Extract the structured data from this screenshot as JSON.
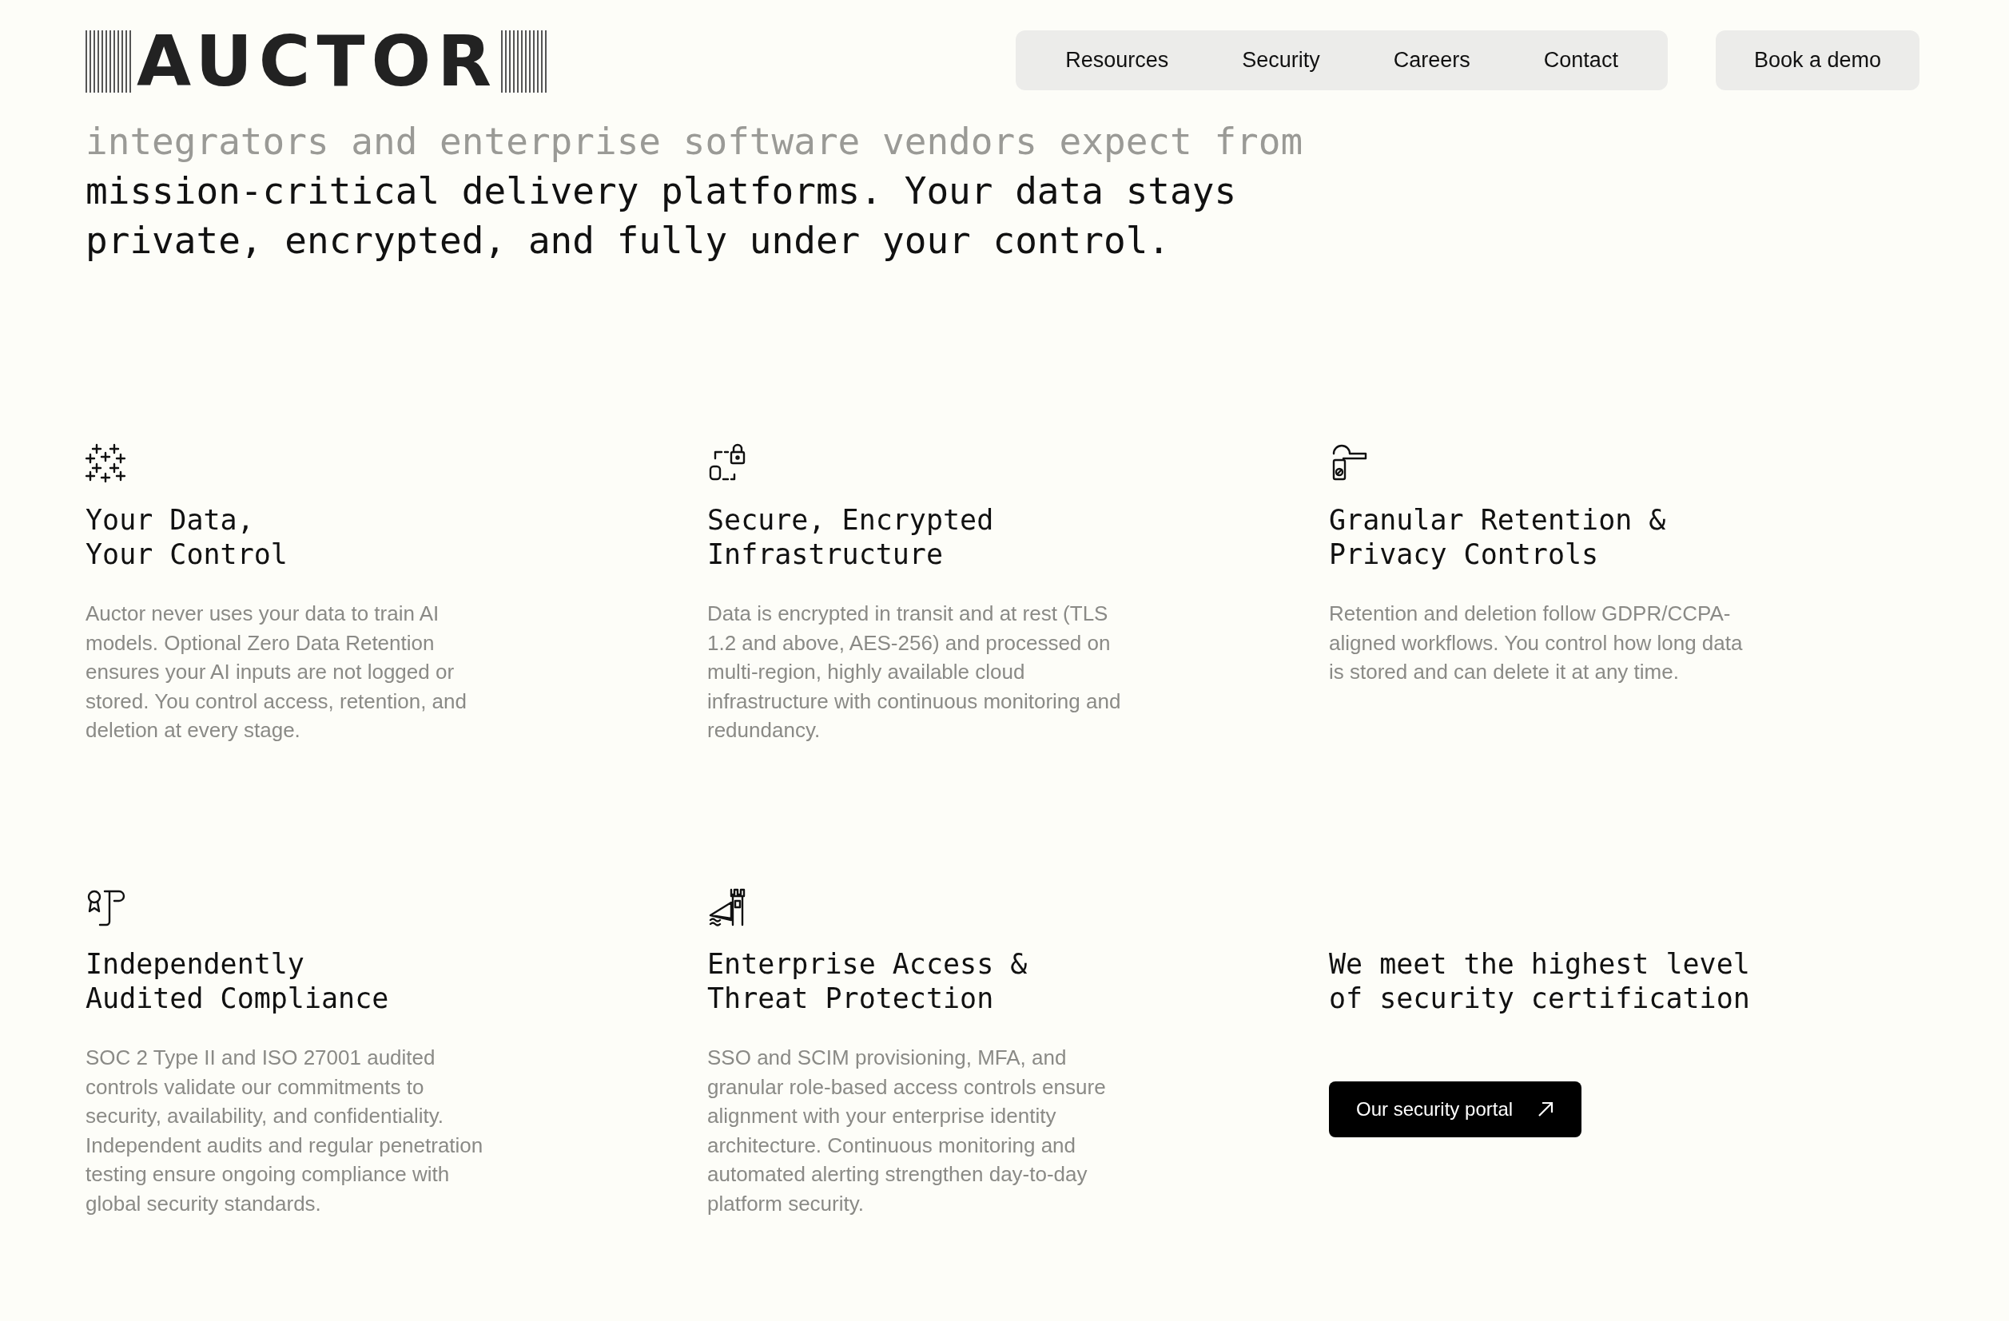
{
  "header": {
    "logo": "AUCTOR",
    "nav": [
      "Resources",
      "Security",
      "Careers",
      "Contact"
    ],
    "cta": "Book a demo"
  },
  "intro": [
    {
      "text": "integrators and enterprise software vendors expect from",
      "faded": true
    },
    {
      "text": "mission-critical delivery platforms. Your data stays",
      "faded": false
    },
    {
      "text": "private, encrypted, and fully under your control.",
      "faded": false
    }
  ],
  "features": [
    {
      "kind": "feature",
      "title": [
        "Your Data,",
        "Your Control"
      ],
      "body": "Auctor never uses your data to train AI models. Optional Zero Data Retention ensures your AI inputs are not logged or stored. You control access, retention, and deletion at every stage."
    },
    {
      "kind": "feature",
      "title": [
        "Secure, Encrypted",
        "Infrastructure"
      ],
      "body": "Data is encrypted in transit and at rest (TLS 1.2 and above, AES-256) and processed on multi-region, highly available cloud infrastructure with continuous monitoring and redundancy."
    },
    {
      "kind": "feature",
      "title": [
        "Granular Retention &",
        "Privacy Controls"
      ],
      "body": "Retention and deletion follow GDPR/CCPA-aligned workflows. You control how long data is stored and can delete it at any time."
    },
    {
      "kind": "feature",
      "title": [
        "Independently",
        "Audited Compliance"
      ],
      "body": "SOC 2 Type II and ISO 27001 audited controls validate our commitments to security, availability, and confidentiality. Independent audits and regular penetration testing ensure ongoing compliance with global security standards."
    },
    {
      "kind": "feature",
      "title": [
        "Enterprise Access &",
        "Threat Protection"
      ],
      "body": "SSO and SCIM provisioning, MFA, and granular role-based access controls ensure alignment with your enterprise identity architecture. Continuous monitoring and automated alerting strengthen day-to-day platform security."
    },
    {
      "kind": "cta",
      "title": [
        "We meet the highest level",
        "of security certification"
      ],
      "button": "Our security portal"
    }
  ]
}
